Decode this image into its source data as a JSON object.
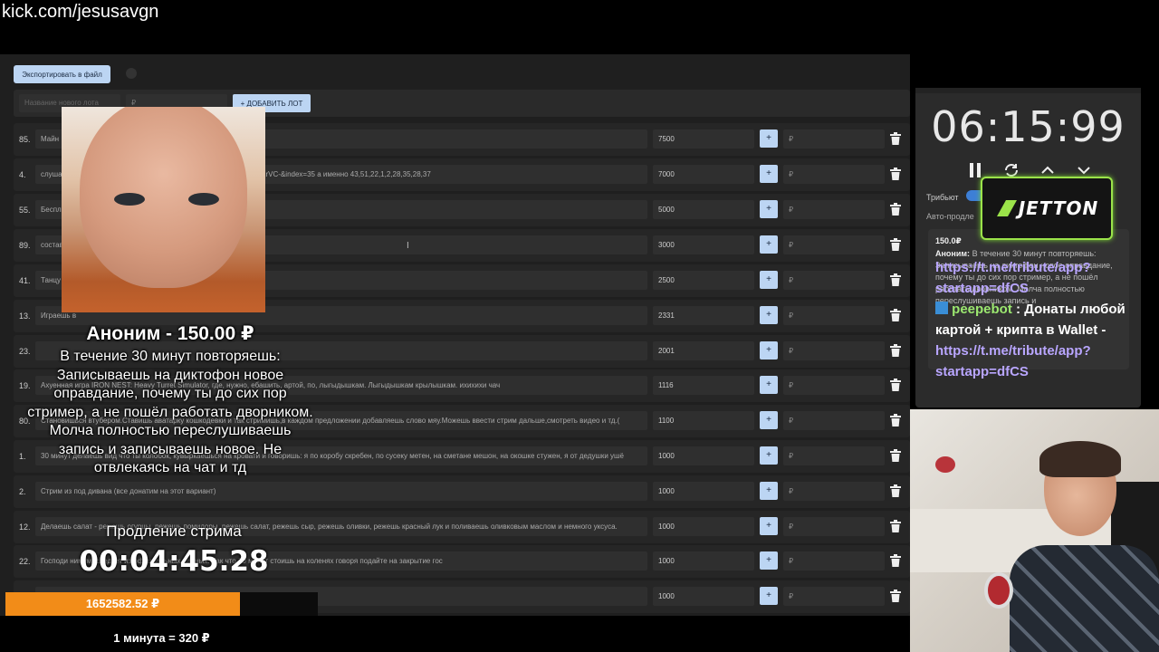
{
  "channel_url": "kick.com/jesusavgn",
  "toolbar": {
    "export_label": "Экспортировать в файл"
  },
  "add_lot": {
    "name_placeholder": "Название нового лота",
    "price_placeholder": "₽",
    "add_label": "+ ДОБАВИТЬ ЛОТ"
  },
  "lots": [
    {
      "num": "85.",
      "title": "Майн",
      "amount": "7500",
      "rub": "₽"
    },
    {
      "num": "4.",
      "title": "слушае                                              =kcw4VPDG9Lw&list=PL2oDcoHo5WQ0YtkDvyplkKRTisN4KrVC-&index=35 а именно 43,51,22,1,2,28,35,28,37",
      "amount": "7000",
      "rub": "₽"
    },
    {
      "num": "55.",
      "title": "Беспл",
      "amount": "5000",
      "rub": "₽"
    },
    {
      "num": "89.",
      "title": "состав                                              шь вилки",
      "amount": "3000",
      "rub": "₽"
    },
    {
      "num": "41.",
      "title": "Танцу                                               ки крылышки / какашки мне в кармашки",
      "amount": "2500",
      "rub": "₽"
    },
    {
      "num": "13.",
      "title": "Играешь в                                           ",
      "amount": "2331",
      "rub": "₽"
    },
    {
      "num": "23.",
      "title": "                                                    ",
      "amount": "2001",
      "rub": "₽"
    },
    {
      "num": "19.",
      "title": "Ахуенная игра IRON NEST: Heavy Turret Simulator, где, нужно, ебашить, артой, по, лыгыдышкам. Лыгыдышкам крылышкам. ихихихи чач",
      "amount": "1116",
      "rub": "₽"
    },
    {
      "num": "80.",
      "title": "Становишься втубером.Ставишь аватарку кошкодевки и так стримишь,в каждом предложении добавляешь слово мяу.Можешь ввести стрим дальше,смотреть видео и тд.(",
      "amount": "1100",
      "rub": "₽"
    },
    {
      "num": "1.",
      "title": "30 минут делаешь вид что ты колобок, кувыркаешься на кровати и говоришь: я по коробу скребен, по сусеку метен, на сметане мешон, на окошке стужен, я от дедушки ушё",
      "amount": "1000",
      "rub": "₽"
    },
    {
      "num": "2.",
      "title": "Стрим из под дивана (все донатим на этот вариант)",
      "amount": "1000",
      "rub": "₽"
    },
    {
      "num": "12.",
      "title": "Делаешь салат - режешь огурцы, режешь помидоры, режешь салат, режешь сыр, режешь оливки, режешь красный лук и поливаешь оливковым маслом и немного уксуса.",
      "amount": "1000",
      "rub": "₽"
    },
    {
      "num": "22.",
      "title": "Господи                                            нимум, следует из официальных данных. Так что 30 минут стоишь на коленях говоря подайте на закрытие гос",
      "amount": "1000",
      "rub": "₽"
    },
    {
      "num": "",
      "title": "                                                                      Q",
      "amount": "1000",
      "rub": "₽"
    }
  ],
  "timer": {
    "value": "06:15:99",
    "tribute_label": "Трибьют",
    "auto_label": "Авто-продле"
  },
  "donate_card": {
    "amount": "150.0₽",
    "author": "Аноним:",
    "text": "В течение 30 минут повторяешь: Записываешь на диктофон новое оправдание, почему ты до сих пор стример, а не пошёл работать дворником. Молча полностью переслушиваешь запись и"
  },
  "jetton": {
    "logo_text": "JETTON"
  },
  "chat": {
    "link_1": "https://t.me/tribute/app?startapp=dfCS",
    "bot_name": "peepebot",
    "bot_sep": " : ",
    "bot_message": "Донаты любой картой + крипта в Wallet -",
    "link_2": "https://t.me/tribute/app?startapp=dfCS"
  },
  "donation": {
    "title": "Аноним - 150.00 ₽",
    "message": "В течение 30 минут повторяешь: Записываешь на диктофон новое оправдание, почему ты до сих пор стример, а не пошёл работать дворником. Молча полностью переслушиваешь запись и записываешь новое. Не отвлекаясь на чат и тд"
  },
  "extension": {
    "label": "Продление стрима",
    "time": "00:04:45.28"
  },
  "total": {
    "value": "1652582.52 ₽",
    "progress_fraction": 0.75
  },
  "rate": "1 минута = 320 ₽",
  "colors": {
    "accent_button": "#bcd5f3",
    "total_bar": "#f28c18",
    "chat_link": "#b9a6ff",
    "chat_bot": "#9ce870",
    "jetton_border": "#9be34a"
  }
}
